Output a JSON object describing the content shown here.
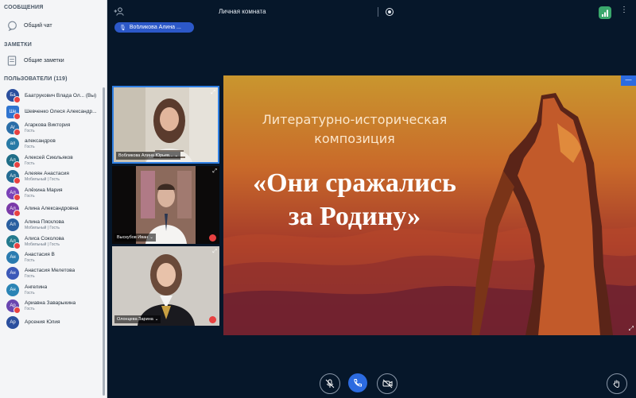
{
  "sidebar": {
    "messages_title": "СООБЩЕНИЯ",
    "general_chat": "Общий чат",
    "notes_title": "ЗАМЕТКИ",
    "shared_notes": "Общие заметки",
    "users_title": "ПОЛЬЗОВАТЕЛИ (119)",
    "users": [
      {
        "initials": "Ба",
        "name": "Баатрукович Влада Ол... (Вы)",
        "role": "",
        "color": "#2b4f9e",
        "square": false,
        "status": true
      },
      {
        "initials": "Ше",
        "name": "Шевченко Олеся Александр...",
        "role": "",
        "color": "#2f74d0",
        "square": true,
        "status": true
      },
      {
        "initials": "Аг",
        "name": "Агаркова Виктория",
        "role": "Гость",
        "color": "#2b6ea8",
        "square": false,
        "status": true
      },
      {
        "initials": "ал",
        "name": "александров",
        "role": "Гость",
        "color": "#287aa6",
        "square": false,
        "status": false
      },
      {
        "initials": "Ал",
        "name": "Алексей Сиюльяков",
        "role": "Гость",
        "color": "#1f6e88",
        "square": false,
        "status": true
      },
      {
        "initials": "Ал",
        "name": "Алеяян Анастасия",
        "role": "Мобильный | Гость",
        "color": "#246c94",
        "square": false,
        "status": true
      },
      {
        "initials": "Ал",
        "name": "Алёхина Мария",
        "role": "Гость",
        "color": "#7a42b8",
        "square": false,
        "status": true
      },
      {
        "initials": "Ал",
        "name": "Алина Александровна",
        "role": "",
        "color": "#7a3aa8",
        "square": false,
        "status": true
      },
      {
        "initials": "Ал",
        "name": "Алина Пясклова",
        "role": "Мобильный | Гость",
        "color": "#2a5fa0",
        "square": false,
        "status": false
      },
      {
        "initials": "Ал",
        "name": "Алиса Соколова",
        "role": "Мобильный | Гость",
        "color": "#237a8e",
        "square": false,
        "status": true
      },
      {
        "initials": "Ан",
        "name": "Анастасия В",
        "role": "Гость",
        "color": "#2a7bb0",
        "square": false,
        "status": false
      },
      {
        "initials": "Ан",
        "name": "Анастасия Мелетова",
        "role": "Гость",
        "color": "#3c59b8",
        "square": false,
        "status": false
      },
      {
        "initials": "Ан",
        "name": "Ангелина",
        "role": "Гость",
        "color": "#2a84b5",
        "square": false,
        "status": false
      },
      {
        "initials": "Ар",
        "name": "Ариавна Заварыкина",
        "role": "Гость",
        "color": "#6a46b0",
        "square": false,
        "status": true
      },
      {
        "initials": "Ар",
        "name": "Арсения Юлия",
        "role": "",
        "color": "#2b4f9e",
        "square": false,
        "status": false
      }
    ]
  },
  "topbar": {
    "room_title": "Личная комната"
  },
  "speaker": {
    "name": "Вобликова Алина ..."
  },
  "videos": [
    {
      "name": "Вобликова Алина Юрьев...",
      "has_menu": true
    },
    {
      "name": "Выскубов Иван",
      "has_menu": true
    },
    {
      "name": "Олонцева Зарина",
      "has_menu": true
    }
  ],
  "slide": {
    "subtitle_line1": "Литературно-историческая",
    "subtitle_line2": "композиция",
    "title_line1": "«Они сражались",
    "title_line2": "за Родину»"
  },
  "colors": {
    "accent": "#2c6be0",
    "mute_red": "#e84141",
    "net_green": "#3aa86c",
    "background": "#06172a"
  },
  "icons": [
    "add-user-icon",
    "record-icon",
    "network-icon",
    "more-icon",
    "mic-off-icon",
    "phone-icon",
    "camera-off-icon",
    "raise-hand-icon",
    "expand-icon"
  ]
}
